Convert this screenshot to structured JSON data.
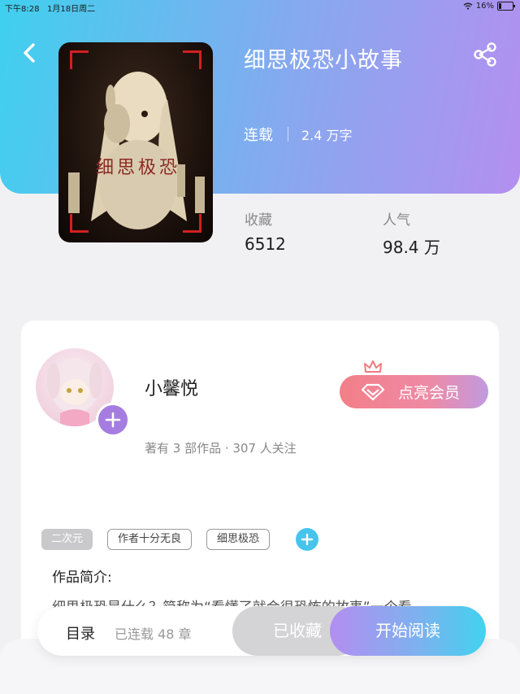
{
  "status_bar": {
    "time": "下午8:28",
    "date": "1月18日周二",
    "battery": "16%"
  },
  "book": {
    "title": "细思极恐小故事",
    "status": "连载",
    "word_count": "2.4 万字",
    "cover_title": "细思极恐"
  },
  "stats": [
    {
      "label": "收藏",
      "value": "6512"
    },
    {
      "label": "人气",
      "value": "98.4 万"
    }
  ],
  "author": {
    "name": "小馨悦",
    "info": "著有 3 部作品 · 307 人关注"
  },
  "vip": {
    "label": "点亮会员"
  },
  "tags": [
    "二次元",
    "作者十分无良",
    "细思极恐"
  ],
  "intro": {
    "heading": "作品简介:",
    "text": "细思极恐是什么？简称为“看懂了就会很恐怖的故事”一个看"
  },
  "bottom_bar": {
    "toc": "目录",
    "chapters": "已连载 48 章",
    "collected": "已收藏",
    "read": "开始阅读"
  },
  "colors": {
    "hero_gradient_start": "#3fd0ef",
    "hero_gradient_end": "#b48ff0",
    "vip_pink": "#f37f88",
    "accent_purple": "#a57de0",
    "tag_add_blue": "#45c4ec"
  },
  "icons": [
    "back-icon",
    "share-icon",
    "wifi-icon",
    "battery-icon",
    "plus-icon",
    "crown-icon",
    "diamond-icon"
  ]
}
